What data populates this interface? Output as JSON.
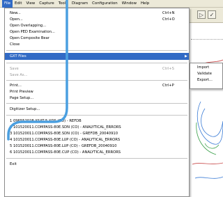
{
  "menubar": {
    "items": [
      "File",
      "Edit",
      "View",
      "Capture",
      "Tools",
      "Diagram",
      "Configuration",
      "Window",
      "Help"
    ]
  },
  "file_menu": {
    "new": {
      "label": "New...",
      "shortcut": "Ctrl+N"
    },
    "open": {
      "label": "Open...",
      "shortcut": "Ctrl+O"
    },
    "open_overlapping": {
      "label": "Open Overlapping..."
    },
    "open_ped": {
      "label": "Open PED Examination..."
    },
    "open_composite": {
      "label": "Open Composite Bear"
    },
    "close": {
      "label": "Close"
    },
    "gxt_files": {
      "label": "GXT Files",
      "submenu_arrow": "▶"
    },
    "save": {
      "label": "Save",
      "shortcut": "Ctrl+S"
    },
    "save_as": {
      "label": "Save As..."
    },
    "print": {
      "label": "Print...",
      "shortcut": "Ctrl+P"
    },
    "print_preview": {
      "label": "Print Preview"
    },
    "page_setup": {
      "label": "Page Setup..."
    },
    "digitizer_setup": {
      "label": "Digitizer Setup..."
    },
    "recent_files": [
      "1 096552028.XSAT-5.XDS (CO) - REFDB",
      "2 101520011.COMPASS-80E.SDN (CO) - ANALYTICAL_ERRORS",
      "3 101520011.COMPASS-80E.SDN (CO) - GREFDB_20040910",
      "4 101520011.COMPASS-80E.LUP (CO) - ANALYTICAL_ERRORS",
      "5 101520011.COMPASS-80E.LUP (CO) - GREFDB_20040910",
      "6 101520011.COMPASS-80E.CUP (CO) - ANALYTICAL_ERRORS"
    ],
    "exit": {
      "label": "Exit"
    }
  },
  "gxt_submenu": {
    "items": [
      "Import",
      "Validate",
      "Export..."
    ]
  },
  "toolbar": {
    "buttons": [
      "▷",
      "✓"
    ]
  },
  "colors": {
    "highlight": "#316ac5",
    "annotation_line": "#4a9fe0",
    "menubar_bg": "#ece9d8"
  }
}
